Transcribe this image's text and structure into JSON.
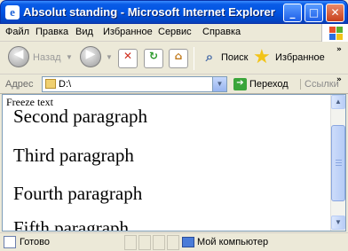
{
  "window": {
    "title": "Absolut standing - Microsoft Internet Explorer",
    "icon": "ie-icon",
    "controls": {
      "minimize": "_",
      "maximize": "□",
      "close": "✕"
    }
  },
  "menu": {
    "items": [
      "Файл",
      "Правка",
      "Вид",
      "Избранное",
      "Сервис",
      "Справка"
    ]
  },
  "toolbar": {
    "back_label": "Назад",
    "search_label": "Поиск",
    "favorites_label": "Избранное",
    "overflow": "»"
  },
  "address": {
    "label": "Адрес",
    "value": "D:\\",
    "go_label": "Переход",
    "links_label": "Ссылки",
    "overflow": "»"
  },
  "page": {
    "freeze_text": "Freeze text",
    "paragraphs": [
      "Second paragraph",
      "Third paragraph",
      "Fourth paragraph",
      "Fifth paragraph"
    ]
  },
  "status": {
    "text": "Готово",
    "zone": "Мой компьютер"
  },
  "colors": {
    "titlebar": "#0054e3",
    "chrome": "#ece9d8",
    "go_green": "#3aa53a",
    "star_yellow": "#f2c418"
  }
}
